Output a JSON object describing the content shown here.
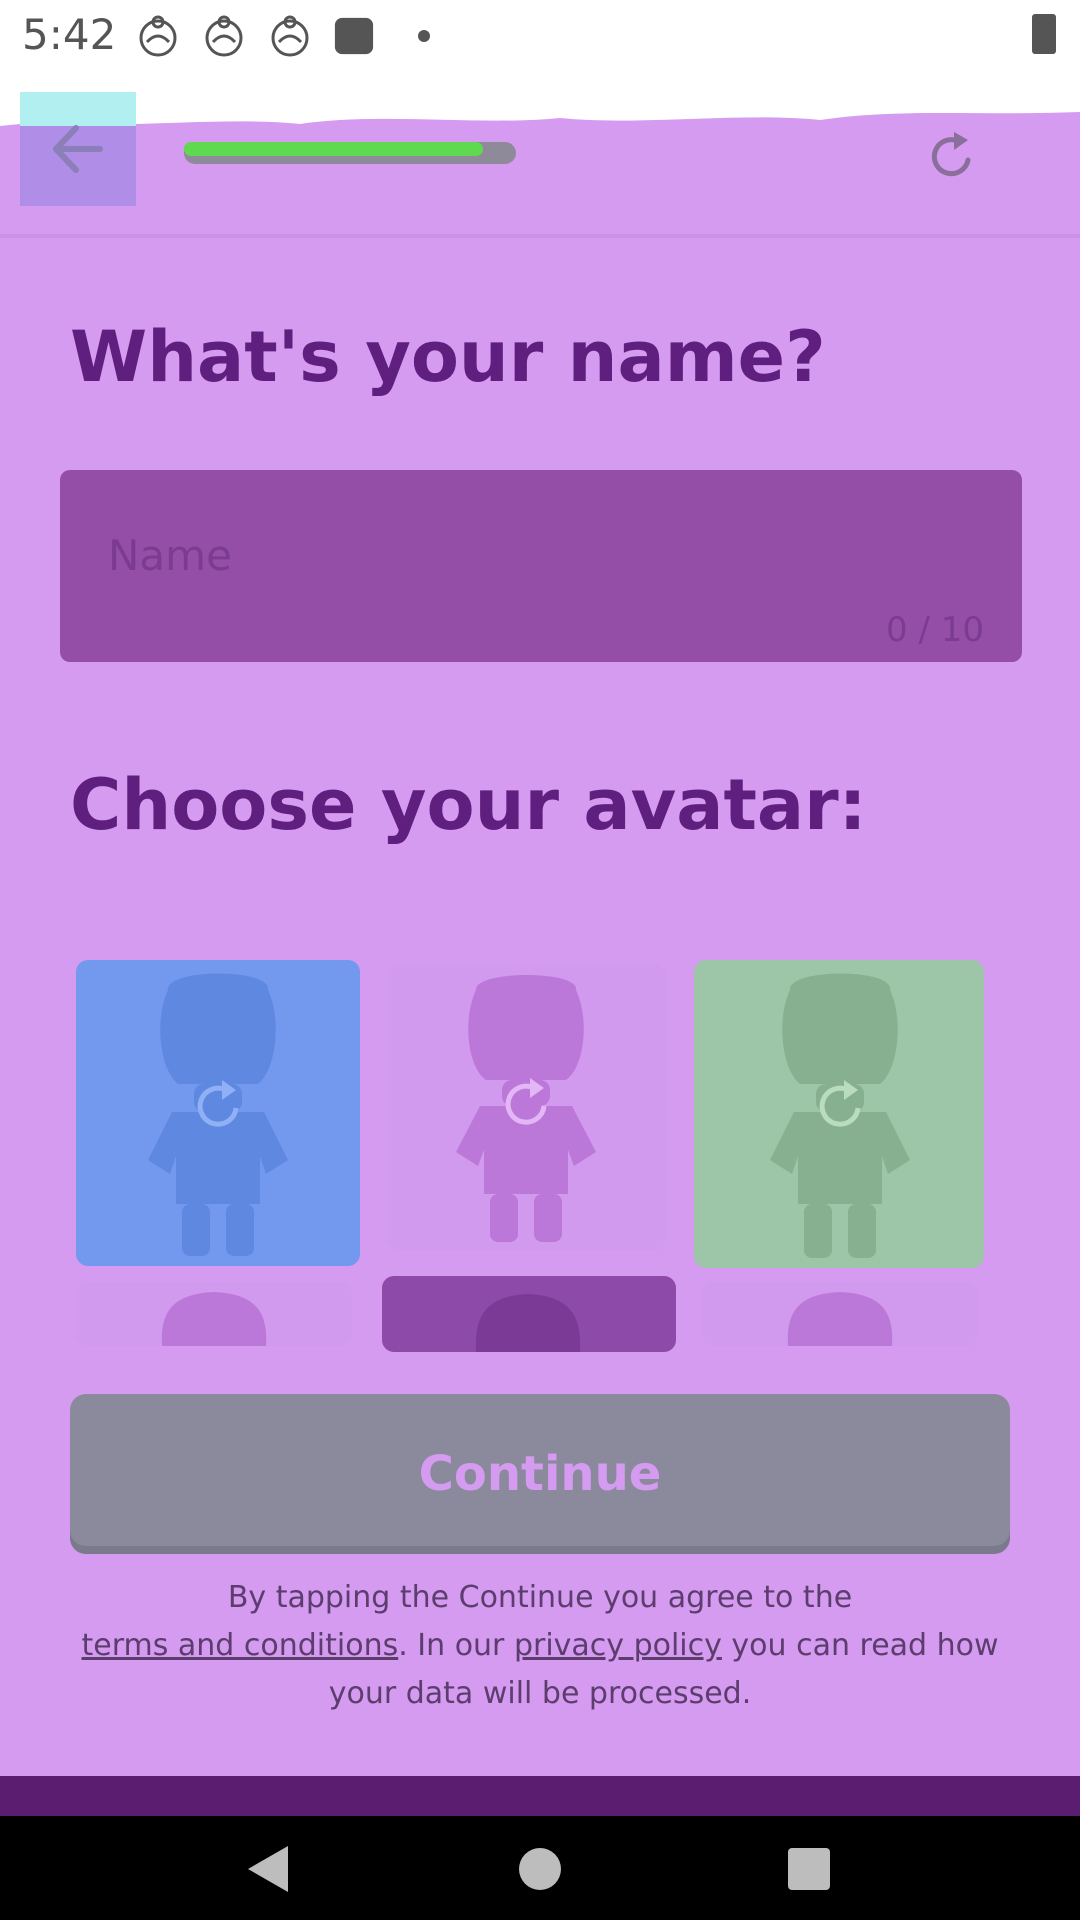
{
  "status_bar": {
    "time": "5:42"
  },
  "header": {
    "progress_value": 0.9
  },
  "name_section": {
    "title": "What's your name?",
    "placeholder": "Name",
    "counter": "0 / 10"
  },
  "avatar_section": {
    "title": "Choose your avatar:"
  },
  "continue": {
    "label": "Continue"
  },
  "terms": {
    "line1": "By tapping the Continue you agree to the",
    "terms_link": "terms and conditions",
    "middle": ". In our ",
    "privacy_link": "privacy policy",
    "tail": " you can read how your data will be processed."
  },
  "colors": {
    "background": "#d49bf0",
    "heading": "#5e1f7e",
    "field": "#954ea8",
    "button": "#8b8a9c",
    "progress": "#5fd94f"
  }
}
